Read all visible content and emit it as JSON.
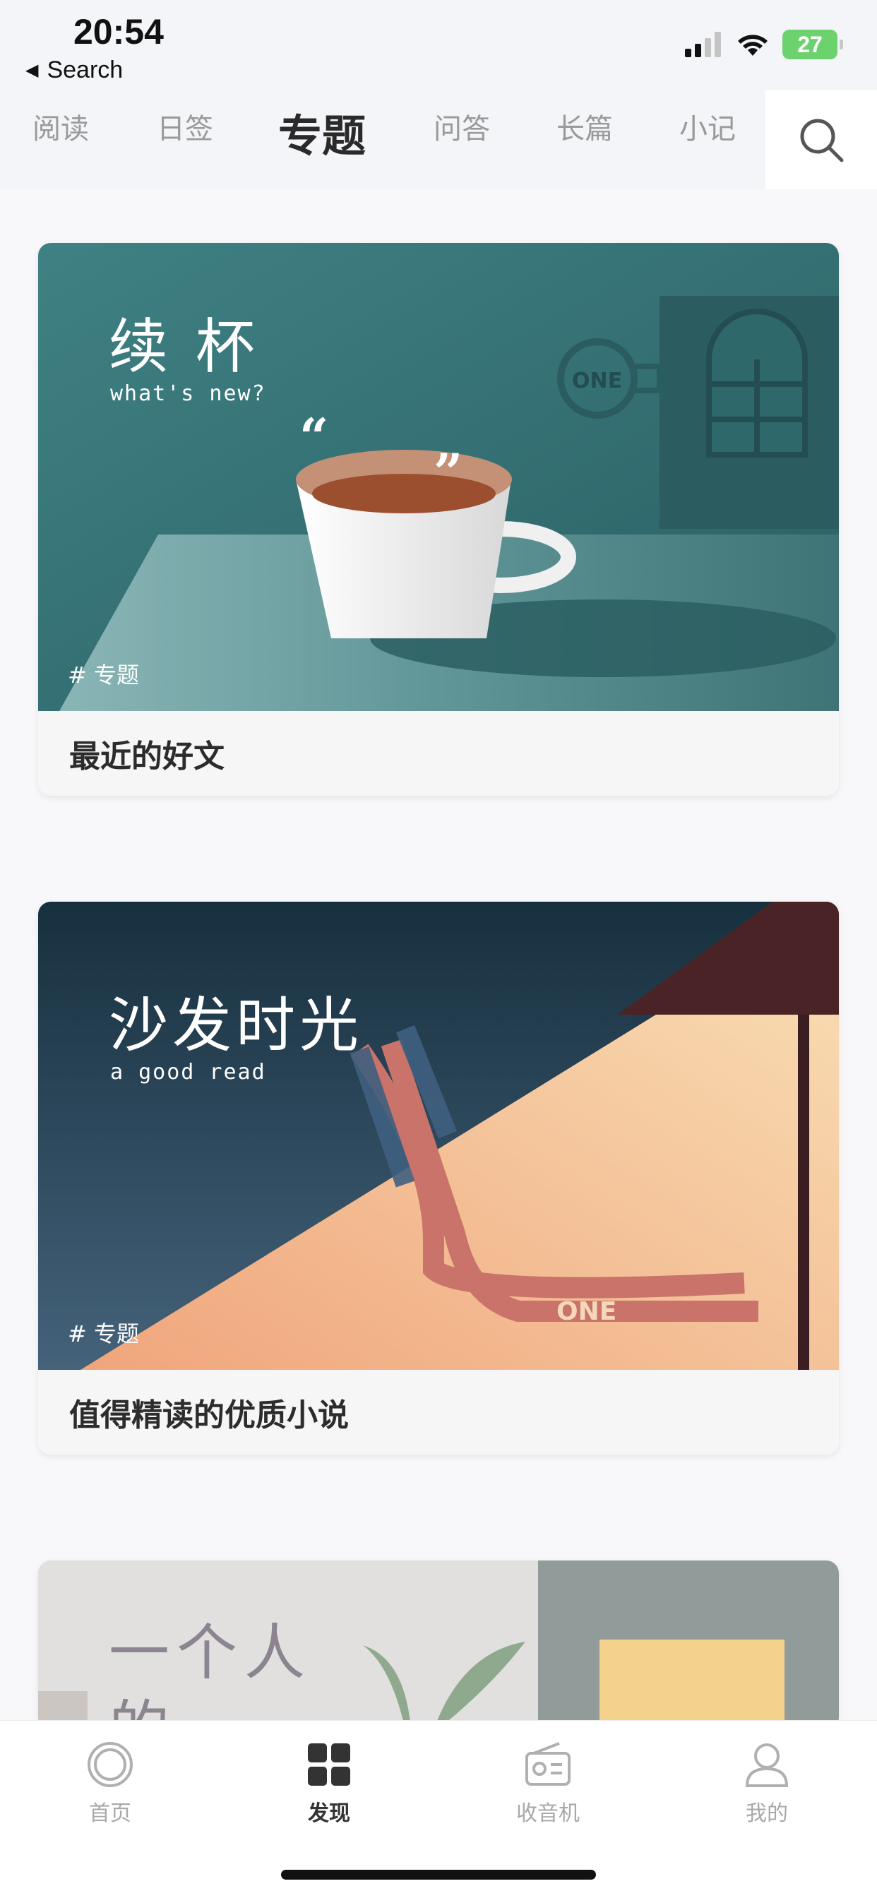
{
  "status_bar": {
    "time": "20:54",
    "back_app": "Search",
    "battery": "27"
  },
  "top_tabs": [
    {
      "label": "阅读"
    },
    {
      "label": "日签"
    },
    {
      "label": "专题",
      "active": true
    },
    {
      "label": "问答"
    },
    {
      "label": "长篇"
    },
    {
      "label": "小记"
    }
  ],
  "search_icon": "search-icon",
  "cards": [
    {
      "art_title": "续 杯",
      "art_subtitle": "what's new?",
      "art_logo": "ONE",
      "tag": "# 专题",
      "title": "最近的好文"
    },
    {
      "art_title": "沙发时光",
      "art_subtitle": "a good read",
      "art_logo": "ONE",
      "tag": "# 专题",
      "title": "值得精读的优质小说"
    },
    {
      "art_title_line1": "一个人",
      "art_title_line2": "的"
    }
  ],
  "bottom_nav": [
    {
      "label": "首页",
      "icon": "home-icon"
    },
    {
      "label": "发现",
      "icon": "discover-icon",
      "active": true
    },
    {
      "label": "收音机",
      "icon": "radio-icon"
    },
    {
      "label": "我的",
      "icon": "profile-icon"
    }
  ],
  "colors": {
    "card1_bg": "#3b7a7c",
    "card2_bg": "#233d50",
    "card2_light": "#f7d5a8",
    "accent_active": "#333333"
  }
}
